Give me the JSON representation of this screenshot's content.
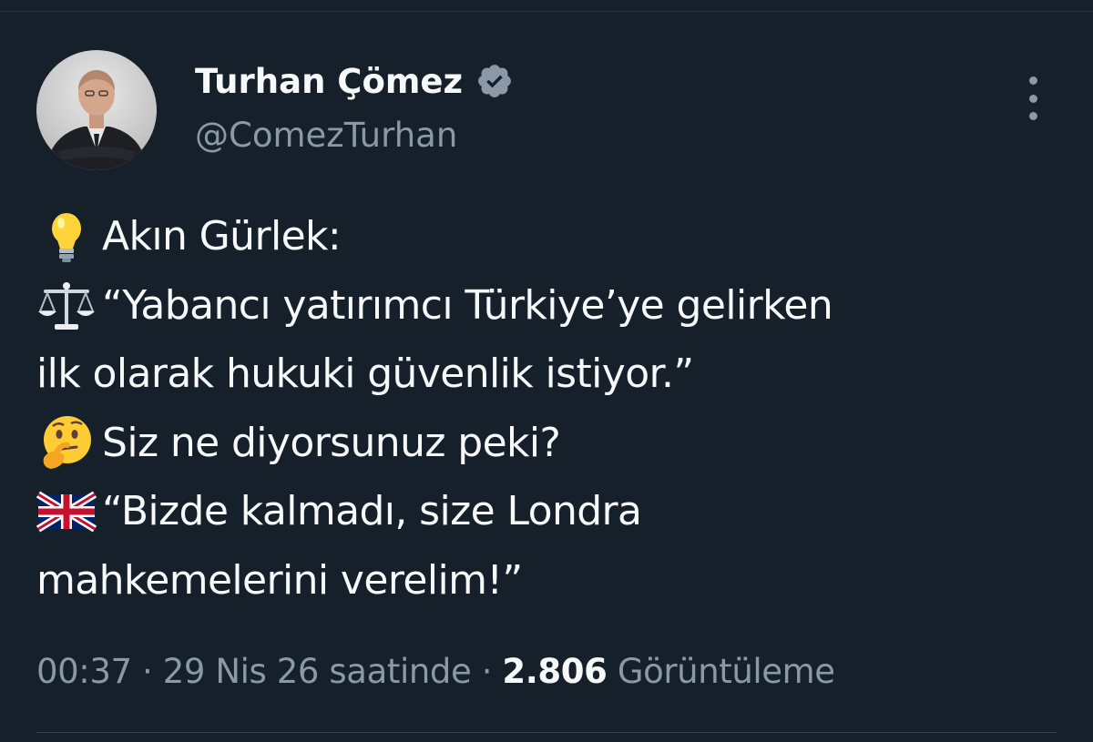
{
  "author": {
    "display_name": "Turhan Çömez",
    "handle": "@ComezTurhan",
    "verified": true
  },
  "tweet": {
    "lines": [
      {
        "emoji": "light-bulb",
        "text": "Akın Gürlek:"
      },
      {
        "emoji": "balance-scale",
        "text": "“Yabancı yatırımcı Türkiye’ye gelirken"
      },
      {
        "emoji": "",
        "text": "ilk olarak hukuki güvenlik istiyor.”"
      },
      {
        "emoji": "thinking-face",
        "text": "Siz ne diyorsunuz peki?"
      },
      {
        "emoji": "uk-flag",
        "text": "“Bizde kalmadı, size Londra"
      },
      {
        "emoji": "",
        "text": "mahkemelerini verelim!”"
      }
    ]
  },
  "meta": {
    "time": "00:37",
    "separator": " · ",
    "date": "29 Nis 26 saatinde",
    "views_count": "2.806",
    "views_label": "Görüntüleme"
  },
  "colors": {
    "background": "#15202b",
    "primary_text": "#f7f9f9",
    "secondary_text": "#8b98a5",
    "verified_badge": "#8b98a5"
  }
}
